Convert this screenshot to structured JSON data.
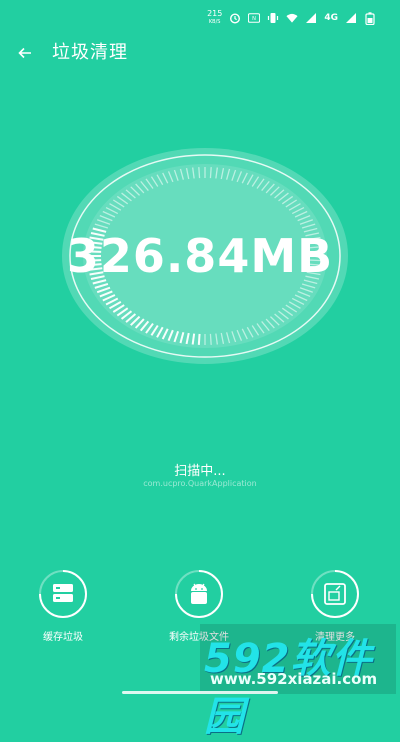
{
  "status_bar": {
    "speed": "215",
    "speed_unit": "KB/S",
    "network_label": "4G",
    "icons": [
      "speed-indicator",
      "alarm-icon",
      "nfc-icon",
      "vibrate-icon",
      "wifi-icon",
      "signal-icon",
      "signal-icon",
      "battery-icon"
    ]
  },
  "header": {
    "back_icon": "back-arrow-icon",
    "title": "垃圾清理"
  },
  "scan": {
    "size": "326.84MB",
    "status": "扫描中...",
    "current_path": "com.ucpro.QuarkApplication"
  },
  "categories": [
    {
      "icon": "cache-icon",
      "label": "缓存垃圾"
    },
    {
      "icon": "android-icon",
      "label": "剩余垃圾文件"
    },
    {
      "icon": "more-clean-icon",
      "label": "清理更多"
    }
  ],
  "watermark": {
    "logo": "592软件园",
    "url": "www.592xiazai.com"
  },
  "colors": {
    "background": "#22cfa1",
    "watermark_logo": "#22e3e8"
  }
}
